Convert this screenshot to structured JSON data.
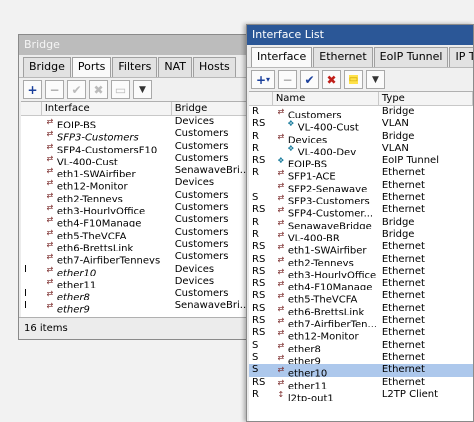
{
  "bridge_window": {
    "title": "Bridge",
    "tabs": [
      "Bridge",
      "Ports",
      "Filters",
      "NAT",
      "Hosts"
    ],
    "active_tab": 1,
    "columns": [
      "",
      "Interface",
      "Bridge"
    ],
    "rows": [
      {
        "flag": "",
        "name": "EOIP-BS",
        "bridge": "Devices",
        "italic": false
      },
      {
        "flag": "",
        "name": "SFP3-Customers",
        "bridge": "Customers",
        "italic": true
      },
      {
        "flag": "",
        "name": "SFP4-CustomersF10",
        "bridge": "Customers",
        "italic": false
      },
      {
        "flag": "",
        "name": "VL-400-Cust",
        "bridge": "Customers",
        "italic": false
      },
      {
        "flag": "",
        "name": "eth1-SWAirfiber",
        "bridge": "SenawaveBri...",
        "italic": false
      },
      {
        "flag": "",
        "name": "eth12-Monitor",
        "bridge": "Devices",
        "italic": false
      },
      {
        "flag": "",
        "name": "eth2-Tenneys",
        "bridge": "Customers",
        "italic": false
      },
      {
        "flag": "",
        "name": "eth3-HourlyOffice",
        "bridge": "Customers",
        "italic": false
      },
      {
        "flag": "",
        "name": "eth4-F10Manage",
        "bridge": "Customers",
        "italic": false
      },
      {
        "flag": "",
        "name": "eth5-TheVCFA",
        "bridge": "Customers",
        "italic": false
      },
      {
        "flag": "",
        "name": "eth6-BrettsLink",
        "bridge": "Customers",
        "italic": false
      },
      {
        "flag": "",
        "name": "eth7-AirfiberTenneys",
        "bridge": "Customers",
        "italic": false
      },
      {
        "flag": "I",
        "name": "ether10",
        "bridge": "Devices",
        "italic": true
      },
      {
        "flag": "",
        "name": "ether11",
        "bridge": "Devices",
        "italic": false
      },
      {
        "flag": "I",
        "name": "ether8",
        "bridge": "Customers",
        "italic": true
      },
      {
        "flag": "I",
        "name": "ether9",
        "bridge": "SenawaveBri...",
        "italic": true
      }
    ],
    "status": "16 items"
  },
  "iflist_window": {
    "title": "Interface List",
    "tabs": [
      "Interface",
      "Ethernet",
      "EoIP Tunnel",
      "IP Tunnel"
    ],
    "active_tab": 0,
    "columns": [
      "",
      "Name",
      "Type"
    ],
    "rows": [
      {
        "flag": "R",
        "name": "Customers",
        "type": "Bridge",
        "icon": "bridge",
        "indent": false,
        "sel": false
      },
      {
        "flag": "RS",
        "name": "VL-400-Cust",
        "type": "VLAN",
        "icon": "vlan",
        "indent": true,
        "sel": false
      },
      {
        "flag": "R",
        "name": "Devices",
        "type": "Bridge",
        "icon": "bridge",
        "indent": false,
        "sel": false
      },
      {
        "flag": "R",
        "name": "VL-400-Dev",
        "type": "VLAN",
        "icon": "vlan",
        "indent": true,
        "sel": false
      },
      {
        "flag": "RS",
        "name": "EOIP-BS",
        "type": "EoIP Tunnel",
        "icon": "eoip",
        "indent": false,
        "sel": false
      },
      {
        "flag": "R",
        "name": "SFP1-ACE",
        "type": "Ethernet",
        "icon": "eth",
        "indent": false,
        "sel": false
      },
      {
        "flag": "",
        "name": "SFP2-Senawave",
        "type": "Ethernet",
        "icon": "eth",
        "indent": false,
        "sel": false
      },
      {
        "flag": "S",
        "name": "SFP3-Customers",
        "type": "Ethernet",
        "icon": "eth",
        "indent": false,
        "sel": false
      },
      {
        "flag": "RS",
        "name": "SFP4-Customer...",
        "type": "Ethernet",
        "icon": "eth",
        "indent": false,
        "sel": false
      },
      {
        "flag": "R",
        "name": "SenawaveBridge",
        "type": "Bridge",
        "icon": "bridge",
        "indent": false,
        "sel": false
      },
      {
        "flag": "R",
        "name": "VL-400-BR",
        "type": "Bridge",
        "icon": "bridge",
        "indent": false,
        "sel": false
      },
      {
        "flag": "RS",
        "name": "eth1-SWAirfiber",
        "type": "Ethernet",
        "icon": "eth",
        "indent": false,
        "sel": false
      },
      {
        "flag": "RS",
        "name": "eth2-Tenneys",
        "type": "Ethernet",
        "icon": "eth",
        "indent": false,
        "sel": false
      },
      {
        "flag": "RS",
        "name": "eth3-HourlyOffice",
        "type": "Ethernet",
        "icon": "eth",
        "indent": false,
        "sel": false
      },
      {
        "flag": "RS",
        "name": "eth4-F10Manage",
        "type": "Ethernet",
        "icon": "eth",
        "indent": false,
        "sel": false
      },
      {
        "flag": "RS",
        "name": "eth5-TheVCFA",
        "type": "Ethernet",
        "icon": "eth",
        "indent": false,
        "sel": false
      },
      {
        "flag": "RS",
        "name": "eth6-BrettsLink",
        "type": "Ethernet",
        "icon": "eth",
        "indent": false,
        "sel": false
      },
      {
        "flag": "RS",
        "name": "eth7-AirfiberTen...",
        "type": "Ethernet",
        "icon": "eth",
        "indent": false,
        "sel": false
      },
      {
        "flag": "RS",
        "name": "eth12-Monitor",
        "type": "Ethernet",
        "icon": "eth",
        "indent": false,
        "sel": false
      },
      {
        "flag": "S",
        "name": "ether8",
        "type": "Ethernet",
        "icon": "eth",
        "indent": false,
        "sel": false
      },
      {
        "flag": "S",
        "name": "ether9",
        "type": "Ethernet",
        "icon": "eth",
        "indent": false,
        "sel": false
      },
      {
        "flag": "S",
        "name": "ether10",
        "type": "Ethernet",
        "icon": "eth",
        "indent": false,
        "sel": true
      },
      {
        "flag": "RS",
        "name": "ether11",
        "type": "Ethernet",
        "icon": "eth",
        "indent": false,
        "sel": false
      },
      {
        "flag": "R",
        "name": "l2tp-out1",
        "type": "L2TP Client",
        "icon": "l2tp",
        "indent": false,
        "sel": false
      }
    ]
  },
  "icons": {
    "bridge": "⇄",
    "vlan": "❖",
    "eoip": "❖",
    "eth": "⇄",
    "l2tp": "↕"
  },
  "toolbar": {
    "add": "+",
    "add_dd": "▾",
    "remove": "−",
    "enable": "✔",
    "disable": "✖",
    "comment": "▭",
    "filter": "▼"
  },
  "colors": {
    "title_active": "#2b5797",
    "selection": "#adc8ec"
  }
}
